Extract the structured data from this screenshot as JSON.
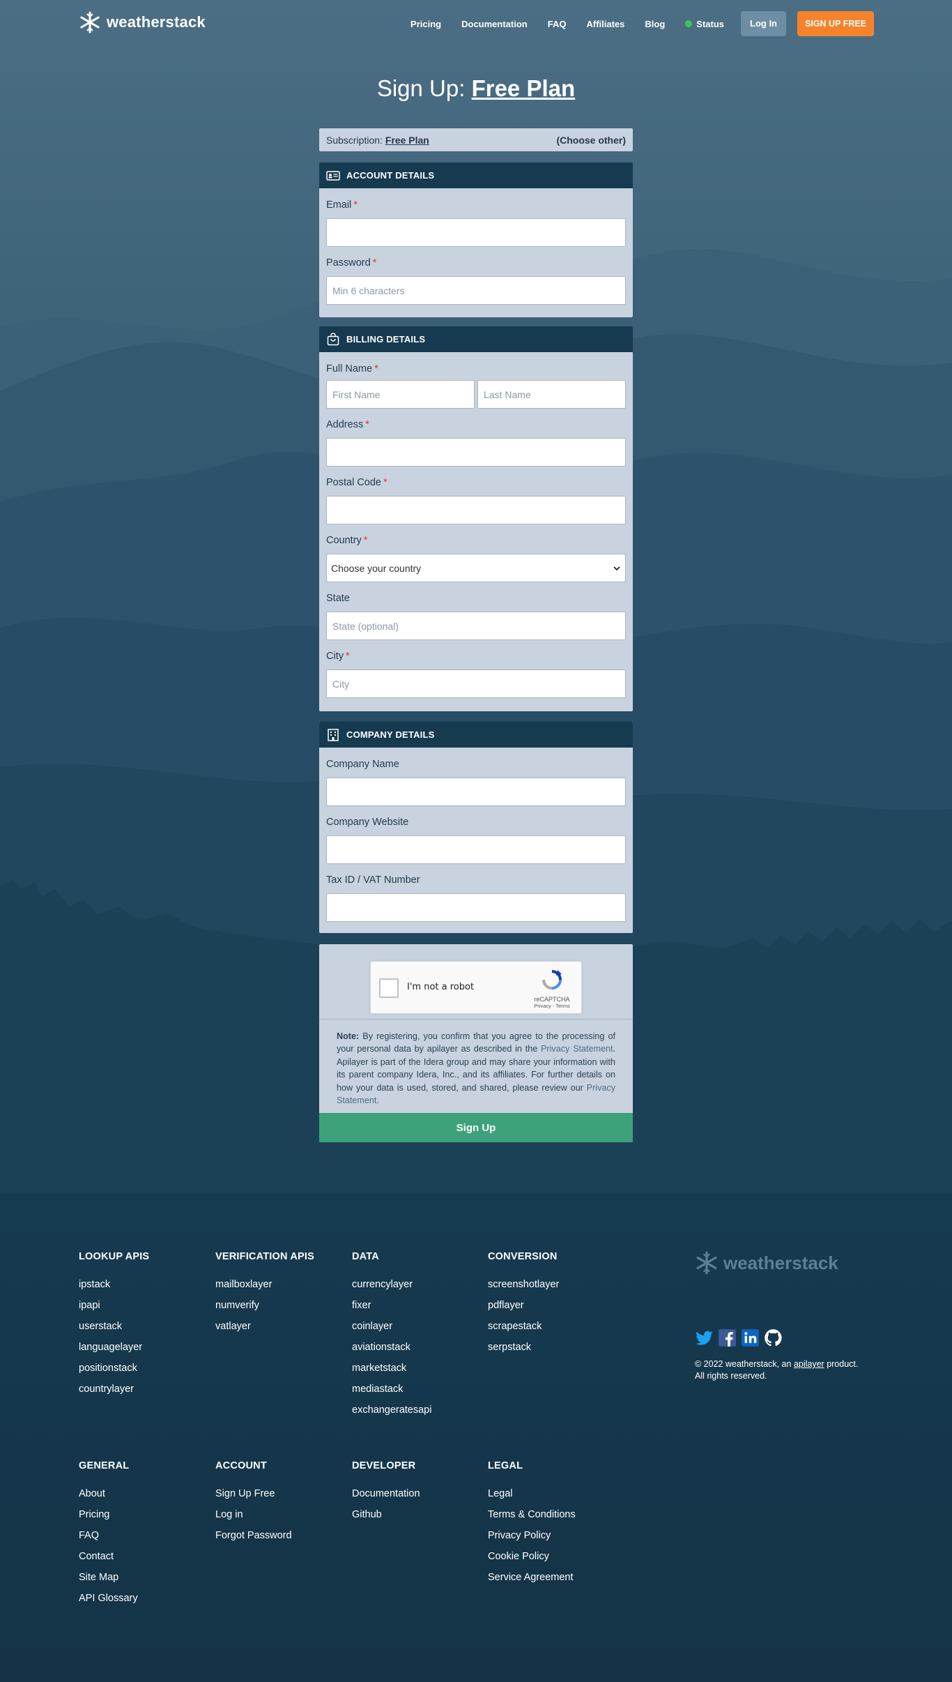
{
  "header": {
    "logo": "weatherstack",
    "nav": [
      {
        "label": "Pricing"
      },
      {
        "label": "Documentation"
      },
      {
        "label": "FAQ"
      },
      {
        "label": "Affiliates"
      },
      {
        "label": "Blog"
      },
      {
        "label": "Status"
      }
    ],
    "login_label": "Log In",
    "signup_label": "SIGN UP FREE",
    "status_color": "#3cc65a"
  },
  "page": {
    "title_prefix": "Sign Up: ",
    "title_plan": "Free Plan"
  },
  "subscription": {
    "label": "Subscription: ",
    "value": "Free Plan",
    "other": "(Choose other)"
  },
  "account": {
    "heading": "ACCOUNT DETAILS",
    "email_label": "Email",
    "email_value": "",
    "password_label": "Password",
    "password_placeholder": "Min 6 characters"
  },
  "billing": {
    "heading": "BILLING DETAILS",
    "fullname_label": "Full Name",
    "first_placeholder": "First Name",
    "last_placeholder": "Last Name",
    "address_label": "Address",
    "postal_label": "Postal Code",
    "country_label": "Country",
    "country_selected": "Choose your country",
    "state_label": "State",
    "state_placeholder": "State (optional)",
    "city_label": "City",
    "city_placeholder": "City"
  },
  "company": {
    "heading": "COMPANY DETAILS",
    "name_label": "Company Name",
    "website_label": "Company Website",
    "tax_label": "Tax ID / VAT Number"
  },
  "captcha": {
    "label": "I'm not a robot",
    "brand": "reCAPTCHA",
    "links": "Privacy - Terms"
  },
  "note": {
    "bold": "Note:",
    "text1": " By registering, you confirm that you agree to the processing of your personal data by apilayer as described in the ",
    "link1": "Privacy Statement",
    "text2": ". Apilayer is part of the Idera group and may share your information with its parent company Idera, Inc., and its affiliates. For further details on how your data is used, stored, and shared, please review our ",
    "link2": "Privacy Statement",
    "text3": "."
  },
  "signup_button": "Sign Up",
  "footer": {
    "columns_top": [
      {
        "title": "LOOKUP APIS",
        "links": [
          "ipstack",
          "ipapi",
          "userstack",
          "languagelayer",
          "positionstack",
          "countrylayer"
        ]
      },
      {
        "title": "VERIFICATION APIS",
        "links": [
          "mailboxlayer",
          "numverify",
          "vatlayer"
        ]
      },
      {
        "title": "DATA",
        "links": [
          "currencylayer",
          "fixer",
          "coinlayer",
          "aviationstack",
          "marketstack",
          "mediastack",
          "exchangeratesapi"
        ]
      },
      {
        "title": "CONVERSION",
        "links": [
          "screenshotlayer",
          "pdflayer",
          "scrapestack",
          "serpstack"
        ]
      }
    ],
    "columns_bottom": [
      {
        "title": "GENERAL",
        "links": [
          "About",
          "Pricing",
          "FAQ",
          "Contact",
          "Site Map",
          "API Glossary"
        ]
      },
      {
        "title": "ACCOUNT",
        "links": [
          "Sign Up Free",
          "Log in",
          "Forgot Password"
        ]
      },
      {
        "title": "DEVELOPER",
        "links": [
          "Documentation",
          "Github"
        ]
      },
      {
        "title": "LEGAL",
        "links": [
          "Legal",
          "Terms & Conditions",
          "Privacy Policy",
          "Cookie Policy",
          "Service Agreement"
        ]
      }
    ],
    "logo": "weatherstack",
    "copyright_prefix": "© 2022 weatherstack, an ",
    "copyright_link": "apilayer",
    "copyright_suffix": " product.",
    "rights": "All rights reserved."
  }
}
